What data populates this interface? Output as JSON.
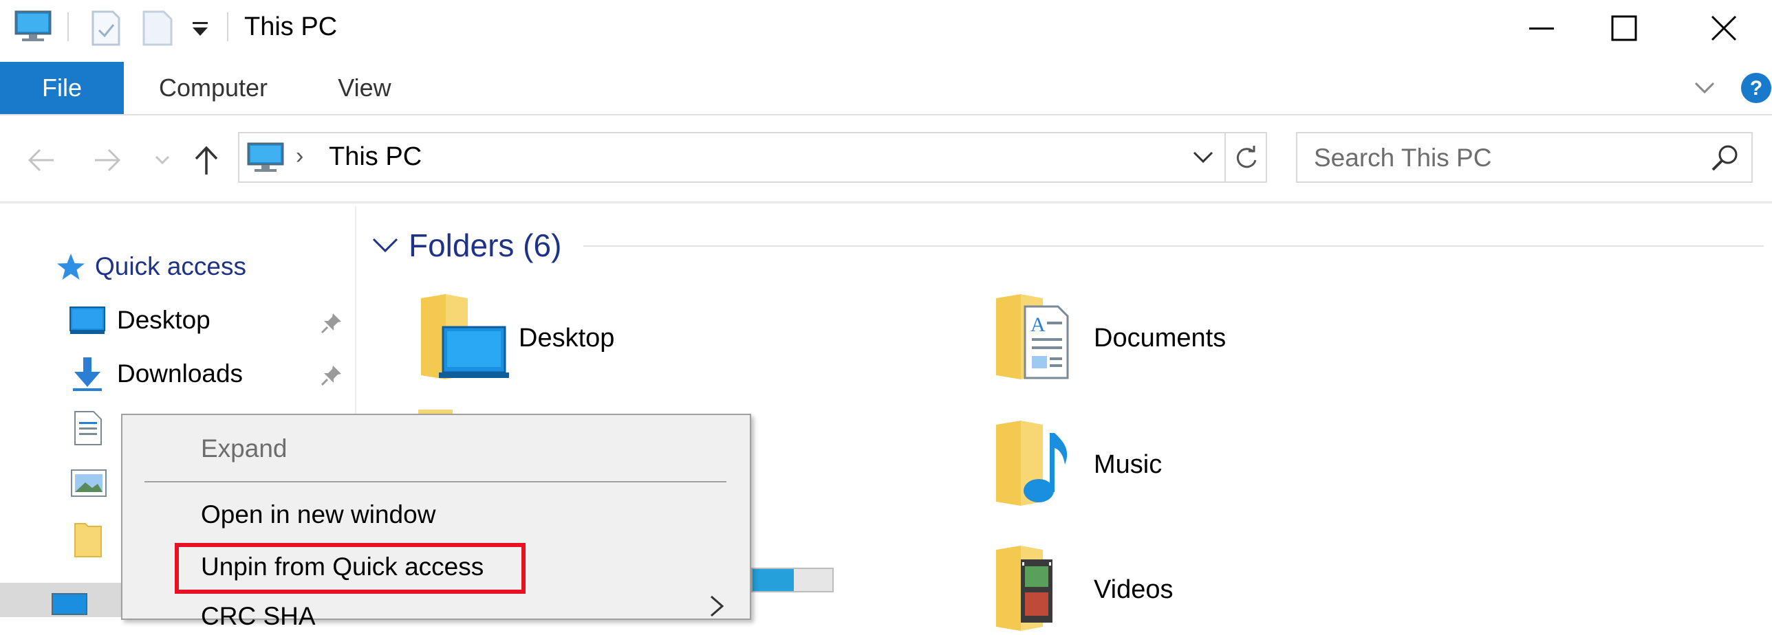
{
  "window": {
    "title": "This PC",
    "controls": {
      "minimize": "minimize",
      "maximize": "maximize",
      "close": "close"
    }
  },
  "ribbon": {
    "tabs": [
      {
        "label": "File",
        "active": true
      },
      {
        "label": "Computer",
        "active": false
      },
      {
        "label": "View",
        "active": false
      }
    ]
  },
  "address": {
    "breadcrumb": [
      "This PC"
    ],
    "search_placeholder": "Search This PC"
  },
  "navpane": {
    "quick_access_label": "Quick access",
    "items": [
      {
        "label": "Desktop",
        "icon": "desktop-icon",
        "pinned": true
      },
      {
        "label": "Downloads",
        "icon": "download-arrow-icon",
        "pinned": true
      }
    ]
  },
  "content": {
    "group_header": "Folders (6)",
    "folders": [
      {
        "label": "Desktop",
        "icon": "desktop-folder-icon"
      },
      {
        "label": "Documents",
        "icon": "documents-folder-icon"
      },
      {
        "label": "Music",
        "icon": "music-folder-icon"
      },
      {
        "label": "Videos",
        "icon": "videos-folder-icon"
      }
    ]
  },
  "context_menu": {
    "items": [
      {
        "label": "Expand",
        "disabled": true
      },
      {
        "label": "Open in new window",
        "disabled": false
      },
      {
        "label": "Unpin from Quick access",
        "disabled": false,
        "highlighted": true
      },
      {
        "label": "CRC SHA",
        "disabled": false,
        "submenu": true
      }
    ]
  },
  "colors": {
    "file_tab": "#1979ca",
    "group_header": "#1e3287",
    "folder_yellow": "#f7d774",
    "highlight_box": "#e81123",
    "help_blue": "#1979ca"
  }
}
